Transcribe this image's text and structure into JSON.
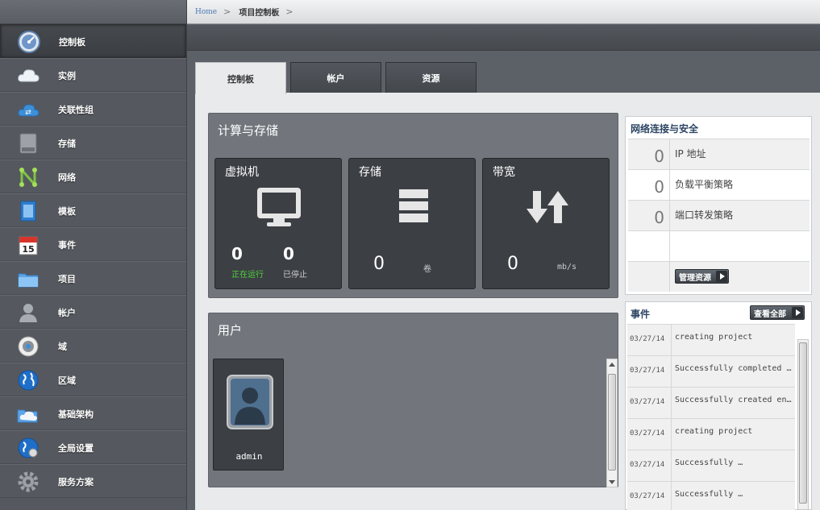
{
  "breadcrumb": {
    "home": "Home",
    "separator": ">",
    "current": "项目控制板"
  },
  "sidebar": {
    "items": [
      {
        "label": "控制板",
        "icon": "dashboard-icon",
        "active": true
      },
      {
        "label": "实例",
        "icon": "cloud-icon"
      },
      {
        "label": "关联性组",
        "icon": "affinity-cloud-icon"
      },
      {
        "label": "存储",
        "icon": "hard-drive-icon"
      },
      {
        "label": "网络",
        "icon": "network-icon"
      },
      {
        "label": "模板",
        "icon": "template-icon"
      },
      {
        "label": "事件",
        "icon": "calendar-icon"
      },
      {
        "label": "项目",
        "icon": "folder-icon"
      },
      {
        "label": "帐户",
        "icon": "user-icon"
      },
      {
        "label": "域",
        "icon": "domain-icon"
      },
      {
        "label": "区域",
        "icon": "globe-icon"
      },
      {
        "label": "基础架构",
        "icon": "infrastructure-icon"
      },
      {
        "label": "全局设置",
        "icon": "global-settings-icon"
      },
      {
        "label": "服务方案",
        "icon": "gear-icon"
      }
    ]
  },
  "tabs": [
    {
      "label": "控制板",
      "active": true
    },
    {
      "label": "帐户"
    },
    {
      "label": "资源"
    }
  ],
  "compute": {
    "title": "计算与存储",
    "vm": {
      "title": "虚拟机",
      "running_count": "0",
      "running_label": "正在运行",
      "stopped_count": "0",
      "stopped_label": "已停止"
    },
    "storage": {
      "title": "存储",
      "count": "0",
      "unit": "卷"
    },
    "bandwidth": {
      "title": "带宽",
      "count": "0",
      "unit": "mb/s"
    }
  },
  "users": {
    "title": "用户",
    "items": [
      {
        "name": "admin"
      }
    ]
  },
  "network": {
    "title": "网络连接与安全",
    "rows": [
      {
        "count": "0",
        "label": "IP 地址"
      },
      {
        "count": "0",
        "label": "负载平衡策略"
      },
      {
        "count": "0",
        "label": "端口转发策略"
      }
    ],
    "manage_button": "管理资源"
  },
  "events": {
    "title": "事件",
    "view_all_button": "查看全部",
    "items": [
      {
        "date": "03/27/14",
        "desc": "creating project"
      },
      {
        "date": "03/27/14",
        "desc": "Successfully completed …"
      },
      {
        "date": "03/27/14",
        "desc": "Successfully created en…"
      },
      {
        "date": "03/27/14",
        "desc": "creating project"
      },
      {
        "date": "03/27/14",
        "desc": "Successfully …"
      },
      {
        "date": "03/27/14",
        "desc": "Successfully …"
      }
    ]
  },
  "colors": {
    "running": "#4fd13d",
    "accent": "#2c4564",
    "link": "#4a78b5"
  }
}
